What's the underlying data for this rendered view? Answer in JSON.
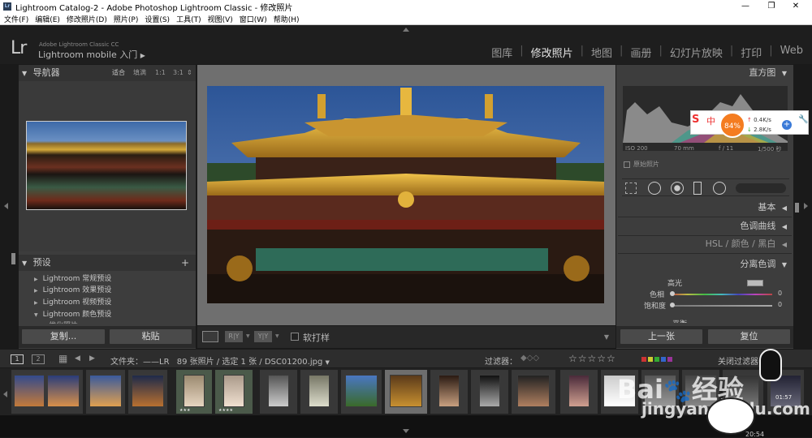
{
  "window": {
    "title": "Lightroom Catalog-2 - Adobe Photoshop Lightroom Classic - 修改照片",
    "app_icon": "Lr",
    "minimize": "—",
    "maximize": "❐",
    "close": "✕"
  },
  "menu": [
    "文件(F)",
    "编辑(E)",
    "修改照片(D)",
    "照片(P)",
    "设置(S)",
    "工具(T)",
    "视图(V)",
    "窗口(W)",
    "帮助(H)"
  ],
  "identity": {
    "logo": "Lr",
    "subtitle": "Adobe Lightroom Classic CC",
    "title": "Lightroom mobile 入门",
    "arrow": "▶"
  },
  "modules": {
    "items": [
      "图库",
      "修改照片",
      "地图",
      "画册",
      "幻灯片放映",
      "打印",
      "Web"
    ],
    "active": "修改照片",
    "separator": "|"
  },
  "navigator": {
    "title": "导航器",
    "zoom_options": [
      "适合",
      "填满",
      "1:1",
      "3:1"
    ],
    "zoom_active": "适合"
  },
  "presets": {
    "title": "预设",
    "add": "+",
    "items": [
      {
        "label": "Lightroom 常规预设",
        "open": false
      },
      {
        "label": "Lightroom 效果预设",
        "open": false
      },
      {
        "label": "Lightroom 视频预设",
        "open": false
      },
      {
        "label": "Lightroom 颜色预设",
        "open": true
      }
    ],
    "partial": "优化照片"
  },
  "left_buttons": {
    "copy": "复制...",
    "paste": "粘贴"
  },
  "toolbar": {
    "view_single": "▭",
    "view_ry": "R|Y",
    "view_yy": "Y|Y",
    "soft_proof": "软打样",
    "soft_proof_checked": false
  },
  "right_panel": {
    "histogram_title": "直方图",
    "exif": [
      "ISO 200",
      "70 mm",
      "f / 11",
      "1/500 秒"
    ],
    "original_photo": "原始照片",
    "sections": [
      {
        "label": "基本"
      },
      {
        "label": "色调曲线"
      },
      {
        "label": "HSL / 颜色 / 黑白"
      },
      {
        "label": "分离色调"
      }
    ],
    "split_toning": {
      "highlights": "高光",
      "hue": "色相",
      "saturation": "饱和度",
      "hue_value": "0",
      "saturation_value": "0",
      "balance": "平衡"
    },
    "buttons": {
      "previous": "上一张",
      "reset": "复位"
    }
  },
  "overlay": {
    "sogou": "S",
    "ime": "中",
    "cpu_percent": "84%",
    "upload": "0.4K/s",
    "download": "2.8K/s",
    "add": "+"
  },
  "filmstrip_bar": {
    "page1": "1",
    "page2": "2",
    "grid_icon": "▦",
    "back": "◀",
    "forward": "▶",
    "folder_label": "文件夹：——LR",
    "count": "89 张照片 / 选定 1 张 /",
    "filename": "DSC01200.jpg",
    "filter_label": "过滤器：",
    "stars": "☆☆☆☆☆",
    "filter_off": "关闭过滤器"
  },
  "thumbnails": [
    {
      "stars": ""
    },
    {
      "stars": ""
    },
    {
      "stars": ""
    },
    {
      "stars": ""
    },
    {
      "stars": "★★★"
    },
    {
      "stars": "★★★★"
    },
    {
      "stars": ""
    },
    {
      "stars": ""
    },
    {
      "stars": ""
    },
    {
      "stars": ""
    },
    {
      "stars": ""
    },
    {
      "stars": ""
    },
    {
      "stars": ""
    },
    {
      "stars": ""
    },
    {
      "stars": ""
    },
    {
      "stars": ""
    },
    {
      "stars": ""
    },
    {
      "stars": ""
    },
    {
      "duration": "01:57"
    }
  ],
  "watermark": {
    "brand": "Bai",
    "brand2": "经验",
    "url": "jingyan.baidu.com"
  },
  "bottom_text": "20:54",
  "colors": {
    "accent": "#e6e6e6",
    "panel": "#3d3d3d",
    "overlay_orange": "#f47c20"
  }
}
